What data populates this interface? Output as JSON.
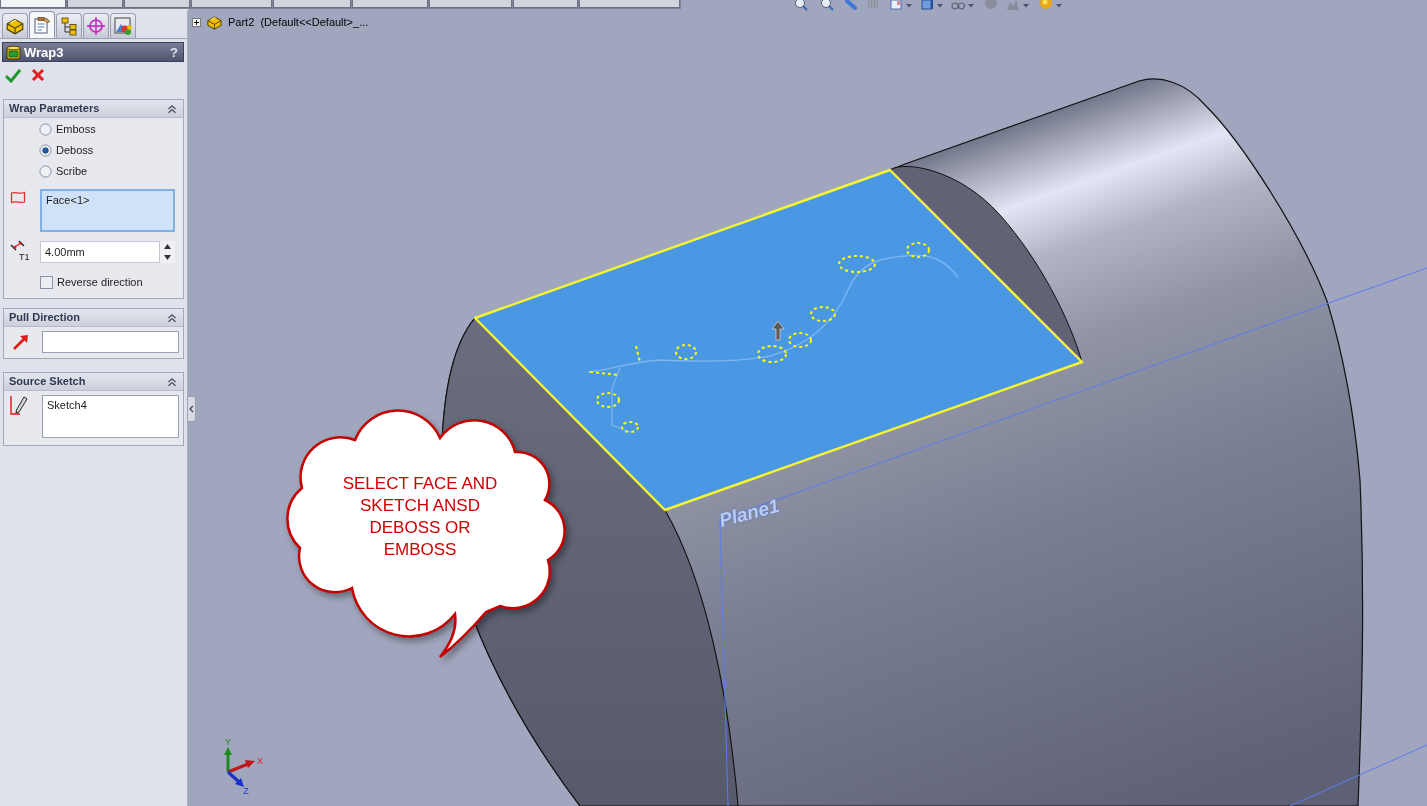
{
  "command_tabs": [
    {
      "selected": true
    },
    {
      "selected": false
    },
    {
      "selected": false
    },
    {
      "selected": false
    },
    {
      "selected": false
    },
    {
      "selected": false
    },
    {
      "selected": false
    },
    {
      "selected": false
    },
    {
      "selected": false
    }
  ],
  "manager_tabs": [
    {
      "kind": "tree",
      "selected": false
    },
    {
      "kind": "properties",
      "selected": true
    },
    {
      "kind": "configurations",
      "selected": false
    },
    {
      "kind": "dimensions",
      "selected": false
    },
    {
      "kind": "display",
      "selected": false
    }
  ],
  "property_manager": {
    "title": "Wrap3",
    "help": "?"
  },
  "wrap_parameters": {
    "heading": "Wrap Parameters",
    "expanded": true,
    "options": [
      {
        "label": "Emboss",
        "selected": false
      },
      {
        "label": "Deboss",
        "selected": true
      },
      {
        "label": "Scribe",
        "selected": false
      }
    ],
    "faces": {
      "active": true,
      "items": [
        "Face<1>"
      ]
    },
    "thickness": {
      "symbol": "T1",
      "value": "4.00mm"
    },
    "reverse_direction": {
      "label": "Reverse direction",
      "checked": false
    }
  },
  "pull_direction": {
    "heading": "Pull Direction",
    "expanded": true
  },
  "source_sketch": {
    "heading": "Source Sketch",
    "expanded": true,
    "sketches": {
      "active": false,
      "items": [
        "Sketch4"
      ]
    }
  },
  "tree_header": {
    "expanded": false,
    "label": "Part2  (Default<<Default>_..."
  },
  "model": {
    "plane_label": "Plane1"
  },
  "callout": {
    "text": "SELECT FACE AND SKETCH ANSD DEBOSS OR EMBOSS"
  },
  "triad": {
    "x": "X",
    "y": "Y",
    "z": "Z"
  }
}
